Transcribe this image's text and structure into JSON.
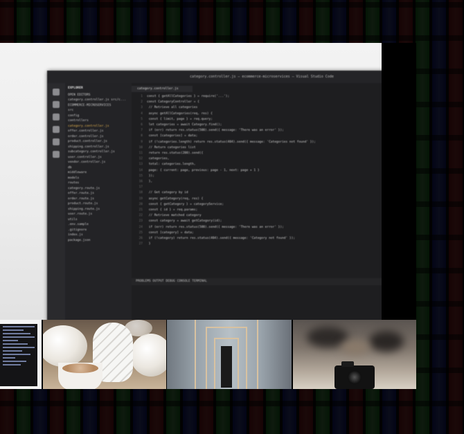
{
  "hero": {
    "window_title": "category.controller.js — ecommerce-microservices — Visual Studio Code",
    "editor_tab": "category.controller.js",
    "explorer_header": "EXPLORER",
    "explorer_files": [
      "OPEN EDITORS",
      "category.controller.js  src/c...",
      "ECOMMERCE-MICROSERVICES",
      "src",
      "config",
      "controllers",
      "category.controller.js",
      "offer.controller.js",
      "order.controller.js",
      "product.controller.js",
      "shipping.controller.js",
      "subcategory.controller.js",
      "user.controller.js",
      "vendor.controller.js",
      "db",
      "middleware",
      "models",
      "routes",
      "category.route.js",
      "offer.route.js",
      "order.route.js",
      "product.route.js",
      "shipping.route.js",
      "user.route.js",
      "utils",
      ".env.sample",
      ".gitignore",
      "index.js",
      "package.json"
    ],
    "code_lines": [
      "const { getAllCategories } = require('...');",
      "const CategoryController = {",
      "  // Retrieve all categories",
      "  async getAllCategories(req, res) {",
      "    const { limit, page } = req.query;",
      "    let categories = await Category.find();",
      "    if (err) return res.status(500).send({ message: 'There was an error' });",
      "    const [categories] = data;",
      "    if (!categories.length) return res.status(404).send({ message: 'Categories not found' });",
      "    // Return categories list",
      "    return res.status(200).send({",
      "      categories,",
      "      total: categories.length,",
      "      page: { current: page, previous: page - 1, next: page + 1 }",
      "    });",
      "  },",
      "",
      "  // Get category by id",
      "  async getCategory(req, res) {",
      "    const { getCategory } = categoryService;",
      "    const { id } = req.params;",
      "    // Retrieve matched category",
      "    const category = await getCategory(id);",
      "    if (err) return res.status(500).send({ message: 'There was an error' });",
      "    const [category] = data;",
      "    if (!category) return res.status(404).send({ message: 'Category not found' });",
      "  }"
    ],
    "terminal_tabs": "PROBLEMS   OUTPUT   DEBUG CONSOLE   TERMINAL"
  },
  "thumbnails": [
    {
      "name": "code-screen-thumbnail"
    },
    {
      "name": "pumpkins-coffee-thumbnail"
    },
    {
      "name": "stairwell-thumbnail"
    },
    {
      "name": "camera-table-thumbnail"
    }
  ]
}
